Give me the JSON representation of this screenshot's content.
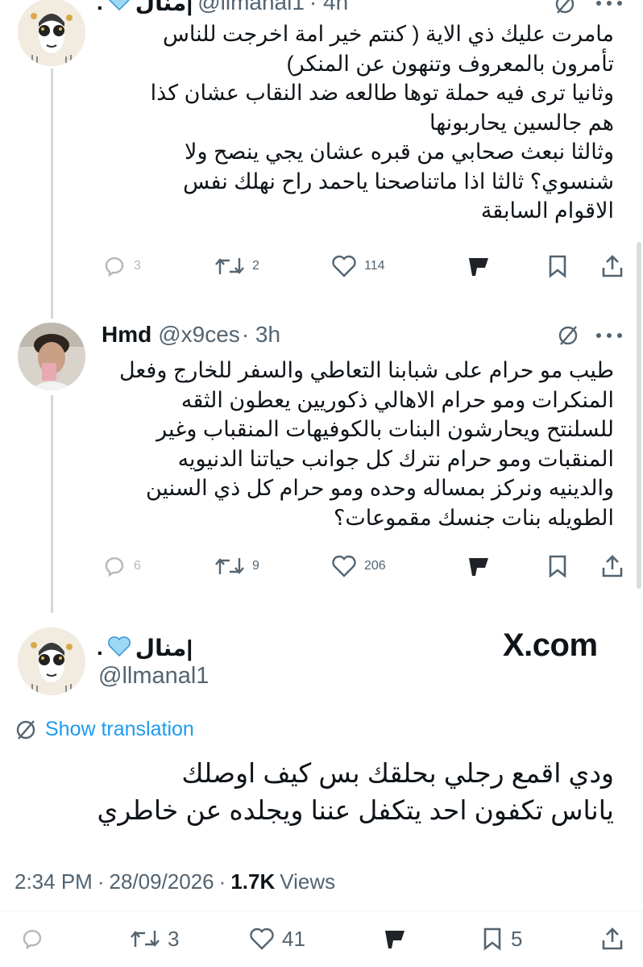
{
  "colors": {
    "accent": "#1d9bf0",
    "text": "#0f1419",
    "muted": "#536471",
    "heart": "#9fd7f6"
  },
  "tweets": [
    {
      "name": "منال|",
      "suffix": ".",
      "handle": "@llmanal1",
      "time": "· 4h",
      "lines": [
        "مامرت عليك ذي الاية ( كنتم خير امة اخرجت للناس",
        "تأمرون بالمعروف وتنهون عن المنكر)",
        "وثانيا ترى فيه حملة توها طالعه ضد النقاب عشان كذا",
        "هم جالسين يحاربونها",
        "وثالثا نبعث صحابي من قبره عشان يجي ينصح ولا",
        "شنسوي؟ ثالثا اذا ماتناصحنا ياحمد راح نهلك نفس",
        "الاقوام السابقة"
      ],
      "replies": "3",
      "reposts": "2",
      "likes": "114"
    },
    {
      "name": "Hmd",
      "handle": "@x9ces",
      "time": "· 3h",
      "lines": [
        "طيب مو حرام على شبابنا التعاطي والسفر للخارج وفعل",
        "المنكرات ومو حرام الاهالي ذكوريين يعطون الثقه",
        "للسلنتح ويحارشون البنات بالكوفيهات المنقباب وغير",
        "المنقبات ومو حرام نترك كل جوانب حياتنا الدنيويه",
        "والدينيه ونركز بمساله وحده ومو حرام كل ذي السنين",
        "الطويله بنات جنسك مقموعات؟"
      ],
      "replies": "6",
      "reposts": "9",
      "likes": "206"
    }
  ],
  "main": {
    "name": "منال|",
    "suffix": ".",
    "handle": "@llmanal1",
    "watermark": "X.com",
    "translate": "Show translation",
    "lines": [
      "ودي اقمع رجلي بحلقك بس كيف اوصلك",
      "ياناس تكفون احد يتكفل عننا ويجلده عن خاطري"
    ],
    "time": "2:34 PM",
    "date": "28/09/2026",
    "views_count": "1.7K",
    "views_label": "Views",
    "replies": "",
    "reposts": "3",
    "likes": "41",
    "bookmarks": "5"
  },
  "icons": [
    "grok-icon",
    "more-icon",
    "reply-icon",
    "repost-icon",
    "like-icon",
    "grok-analyze-icon",
    "bookmark-icon",
    "share-icon",
    "translate-icon",
    "blue-heart-icon"
  ]
}
